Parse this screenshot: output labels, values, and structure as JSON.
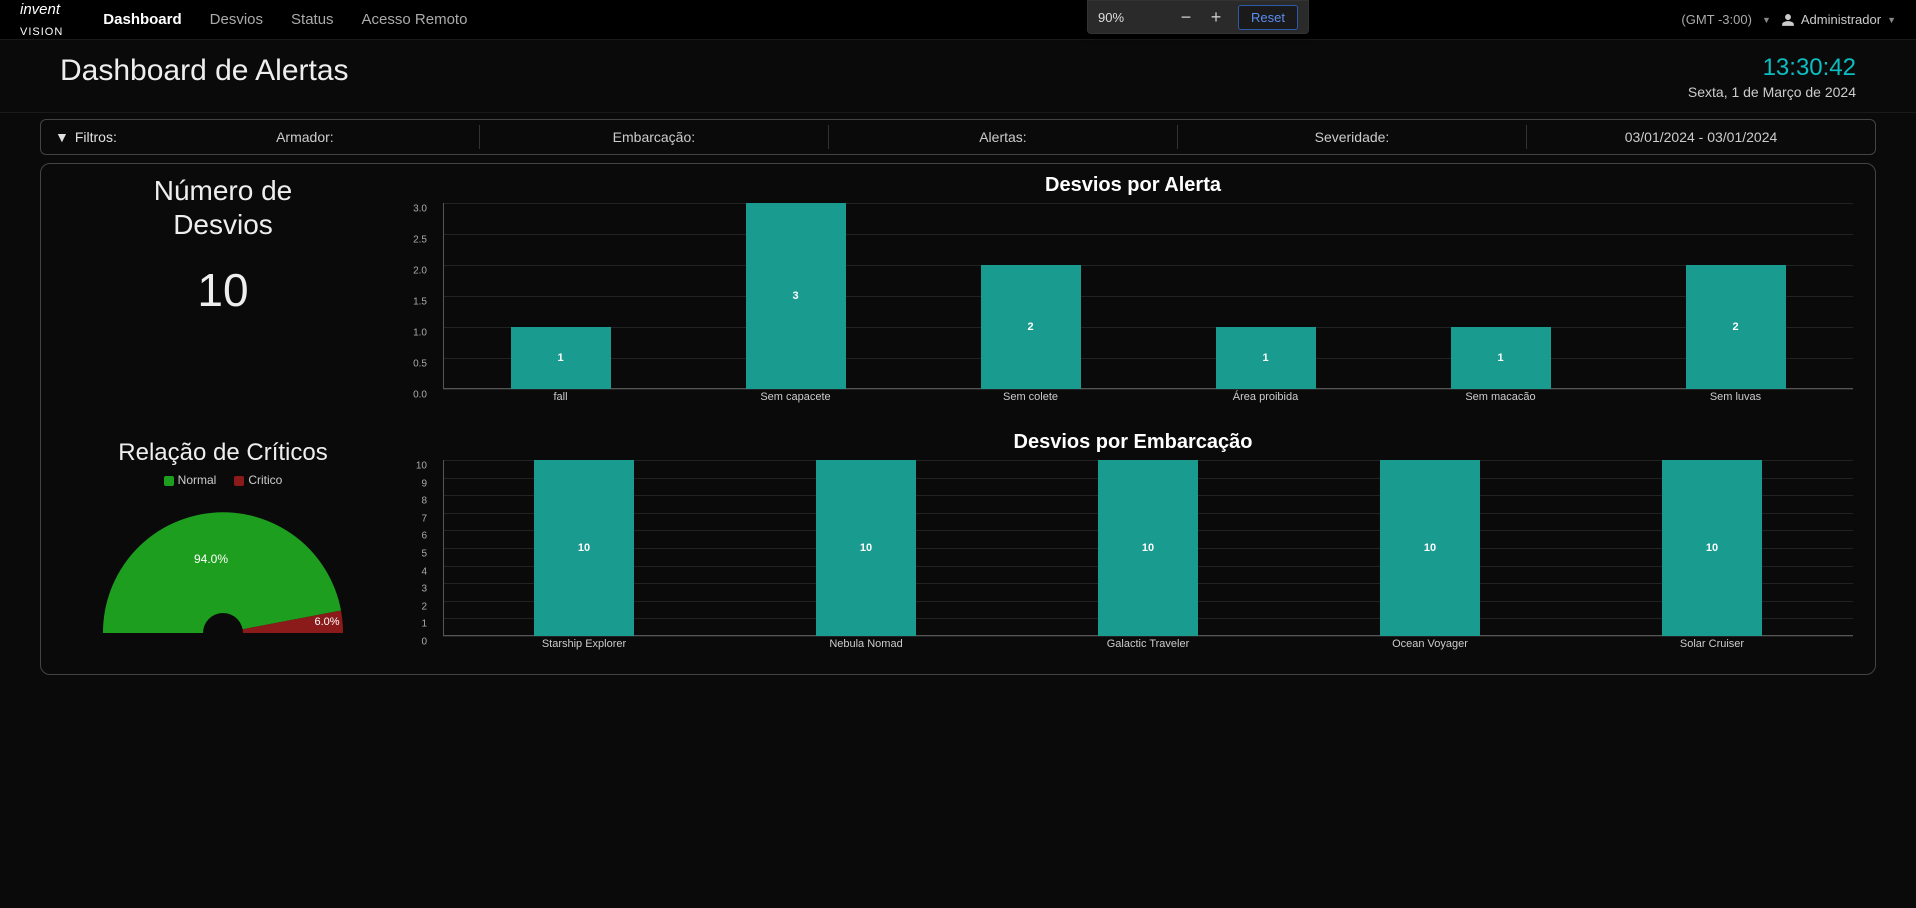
{
  "brand": "invent vision",
  "nav": {
    "items": [
      "Dashboard",
      "Desvios",
      "Status",
      "Acesso Remoto"
    ],
    "active": "Dashboard"
  },
  "zoom": {
    "pct": "90%",
    "reset": "Reset"
  },
  "timezone": "(GMT -3:00)",
  "user": "Administrador",
  "page": {
    "title": "Dashboard de Alertas",
    "clock": "13:30:42",
    "date": "Sexta, 1 de Março de 2024"
  },
  "filters": {
    "label": "Filtros:",
    "armador": "Armador:",
    "embarcacao": "Embarcação:",
    "alertas": "Alertas:",
    "severidade": "Severidade:",
    "daterange": "03/01/2024 - 03/01/2024"
  },
  "kpi": {
    "title1": "Número de",
    "title2": "Desvios",
    "value": "10"
  },
  "gauge": {
    "title": "Relação de Críticos",
    "legend": {
      "normal": "Normal",
      "critico": "Critico"
    },
    "normal_pct": "94.0%",
    "critico_pct": "6.0%"
  },
  "chart1_title": "Desvios por Alerta",
  "chart2_title": "Desvios por Embarcação",
  "chart_data": [
    {
      "type": "bar",
      "title": "Desvios por Alerta",
      "categories": [
        "fall",
        "Sem capacete",
        "Sem colete",
        "Área proibida",
        "Sem macacão",
        "Sem luvas"
      ],
      "values": [
        1,
        3,
        2,
        1,
        1,
        2
      ],
      "ylim": [
        0,
        3
      ],
      "yticks": [
        0.0,
        0.5,
        1.0,
        1.5,
        2.0,
        2.5,
        3.0
      ],
      "bar_color": "#1a9b8f"
    },
    {
      "type": "bar",
      "title": "Desvios por Embarcação",
      "categories": [
        "Starship Explorer",
        "Nebula Nomad",
        "Galactic Traveler",
        "Ocean Voyager",
        "Solar Cruiser"
      ],
      "values": [
        10,
        10,
        10,
        10,
        10
      ],
      "ylim": [
        0,
        10
      ],
      "yticks": [
        0,
        1,
        2,
        3,
        4,
        5,
        6,
        7,
        8,
        9,
        10
      ],
      "bar_color": "#1a9b8f"
    },
    {
      "type": "pie",
      "title": "Relação de Críticos",
      "series": [
        {
          "name": "Normal",
          "value": 94.0,
          "color": "#1e9e1e"
        },
        {
          "name": "Critico",
          "value": 6.0,
          "color": "#8b1a1a"
        }
      ]
    }
  ]
}
